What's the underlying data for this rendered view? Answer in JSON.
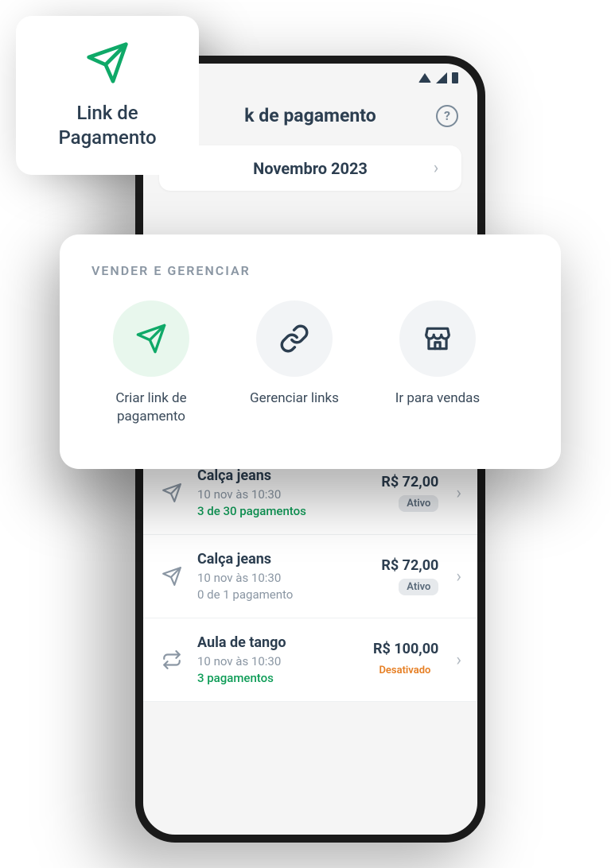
{
  "floating_tile": {
    "label": "Link de Pagamento"
  },
  "header": {
    "title": "k de pagamento"
  },
  "month_selector": {
    "label": "Novembro 2023"
  },
  "action_card": {
    "title": "VENDER E GERENCIAR",
    "items": {
      "create": "Criar link de pagamento",
      "manage": "Gerenciar links",
      "sales": "Ir para vendas"
    }
  },
  "links": [
    {
      "title": "Calça jeans",
      "date": "10 nov às 10:30",
      "payments": "3 de 30 pagamentos",
      "payments_color": "green",
      "price": "R$ 72,00",
      "status": "Ativo",
      "status_class": "active",
      "icon": "send"
    },
    {
      "title": "Calça jeans",
      "date": "10 nov às 10:30",
      "payments": "0 de 1 pagamento",
      "payments_color": "gray",
      "price": "R$ 72,00",
      "status": "Ativo",
      "status_class": "active",
      "icon": "send"
    },
    {
      "title": "Aula de tango",
      "date": "10 nov às 10:30",
      "payments": "3 pagamentos",
      "payments_color": "green",
      "price": "R$ 100,00",
      "status": "Desativado",
      "status_class": "disabled",
      "icon": "cycle"
    }
  ]
}
